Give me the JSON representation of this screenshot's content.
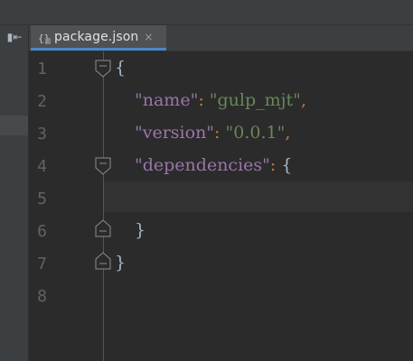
{
  "toolbar": {
    "collapse_glyph": "▮⇤"
  },
  "tab": {
    "label": "package.json",
    "close_glyph": "×",
    "icon": "json-file-icon"
  },
  "editor": {
    "line_numbers": [
      "1",
      "2",
      "3",
      "4",
      "5",
      "6",
      "7",
      "8"
    ],
    "lines": {
      "l1": {
        "brace": "{"
      },
      "l2": {
        "key": "\"name\"",
        "colon": ": ",
        "value": "\"gulp_mjt\"",
        "comma": ","
      },
      "l3": {
        "key": "\"version\"",
        "colon": ": ",
        "value": "\"0.0.1\"",
        "comma": ","
      },
      "l4": {
        "key": "\"dependencies\"",
        "colon": ": ",
        "brace": "{"
      },
      "l6": {
        "brace": "}"
      },
      "l7": {
        "brace": "}"
      }
    }
  },
  "colors": {
    "background": "#2b2b2b",
    "panel": "#3c3f41",
    "key": "#9876aa",
    "string": "#6a8759",
    "punctuation": "#cc7832",
    "text": "#a9b7c6",
    "line_number": "#606366",
    "tab_underline": "#4a88c7"
  }
}
